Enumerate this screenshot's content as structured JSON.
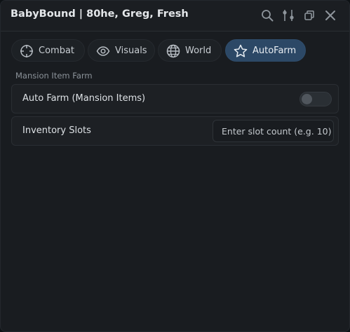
{
  "window": {
    "title": "BabyBound | 80he, Greg, Fresh",
    "controls": [
      "search-icon",
      "settings-sliders-icon",
      "restore-icon",
      "close-icon"
    ]
  },
  "tabs": [
    {
      "label": "Combat",
      "icon": "crosshair-icon",
      "active": false
    },
    {
      "label": "Visuals",
      "icon": "eye-icon",
      "active": false
    },
    {
      "label": "World",
      "icon": "globe-icon",
      "active": false
    },
    {
      "label": "AutoFarm",
      "icon": "star-icon",
      "active": true
    }
  ],
  "section": {
    "title": "Mansion Item Farm",
    "rows": [
      {
        "label": "Auto Farm (Mansion Items)",
        "type": "toggle",
        "enabled": false
      },
      {
        "label": "Inventory Slots",
        "type": "textbox",
        "value": "",
        "placeholder": "Enter slot count (e.g. 10)"
      }
    ]
  },
  "colors": {
    "accent": "#2c4866",
    "background": "#191c20",
    "text": "#dde1e5"
  }
}
